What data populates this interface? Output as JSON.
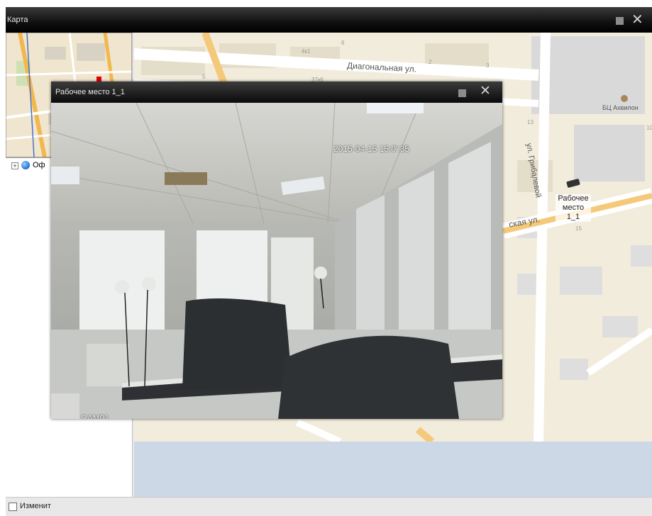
{
  "main_window": {
    "title": "Карта"
  },
  "tree": {
    "expander": "+",
    "root_label": "Оф"
  },
  "map": {
    "streets": [
      "Диагональная ул.",
      "ул. Грибалевой",
      "ская ул."
    ],
    "poi": "БЦ Ахвилон",
    "house_numbers": [
      "4к1",
      "37к6",
      "5",
      "6",
      "2",
      "3",
      "13",
      "2",
      "10",
      "15"
    ]
  },
  "camera_marker": {
    "label_line1": "Рабочее",
    "label_line2": "место 1_1"
  },
  "camera_window": {
    "title": "Рабочее место 1_1",
    "timestamp": "2015-04-15 15:0':35",
    "camera_name": "CAM01"
  },
  "status": {
    "edit_checkbox_label": "Изменит",
    "edit_checked": false
  },
  "colors": {
    "titlebar": "#000000",
    "map_background": "#f2ecdc",
    "road_major": "#f5c97a"
  }
}
